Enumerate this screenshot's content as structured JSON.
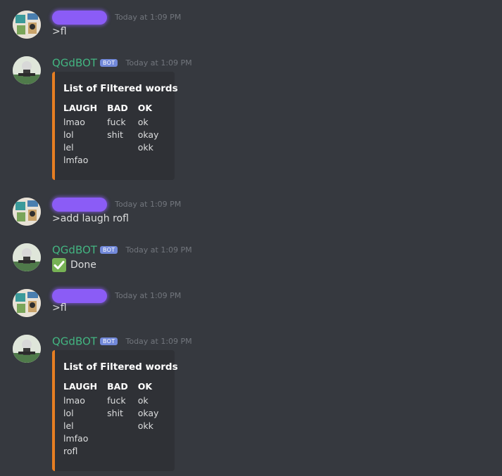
{
  "messages": [
    {
      "type": "user",
      "timestamp": "Today at 1:09 PM",
      "text": ">fl"
    },
    {
      "type": "bot",
      "author": "QGdBOT",
      "badge": "BOT",
      "timestamp": "Today at 1:09 PM",
      "embed": {
        "title": "List of Filtered words",
        "fields": [
          {
            "name": "LAUGH",
            "values": [
              "lmao",
              "lol",
              "lel",
              "lmfao"
            ]
          },
          {
            "name": "BAD",
            "values": [
              "fuck",
              "shit"
            ]
          },
          {
            "name": "OK",
            "values": [
              "ok",
              "okay",
              "okk"
            ]
          }
        ]
      }
    },
    {
      "type": "user",
      "timestamp": "Today at 1:09 PM",
      "text": ">add laugh rofl"
    },
    {
      "type": "bot",
      "author": "QGdBOT",
      "badge": "BOT",
      "timestamp": "Today at 1:09 PM",
      "text": "Done",
      "icon": "check-mark-icon"
    },
    {
      "type": "user",
      "timestamp": "Today at 1:09 PM",
      "text": ">fl"
    },
    {
      "type": "bot",
      "author": "QGdBOT",
      "badge": "BOT",
      "timestamp": "Today at 1:09 PM",
      "embed": {
        "title": "List of Filtered words",
        "fields": [
          {
            "name": "LAUGH",
            "values": [
              "lmao",
              "lol",
              "lel",
              "lmfao",
              "rofl"
            ]
          },
          {
            "name": "BAD",
            "values": [
              "fuck",
              "shit"
            ]
          },
          {
            "name": "OK",
            "values": [
              "ok",
              "okay",
              "okk"
            ]
          }
        ]
      }
    }
  ],
  "colors": {
    "bot_name": "#43b581",
    "embed_accent": "#e67e22",
    "redaction": "#8b5cf6",
    "badge": "#7289da"
  }
}
